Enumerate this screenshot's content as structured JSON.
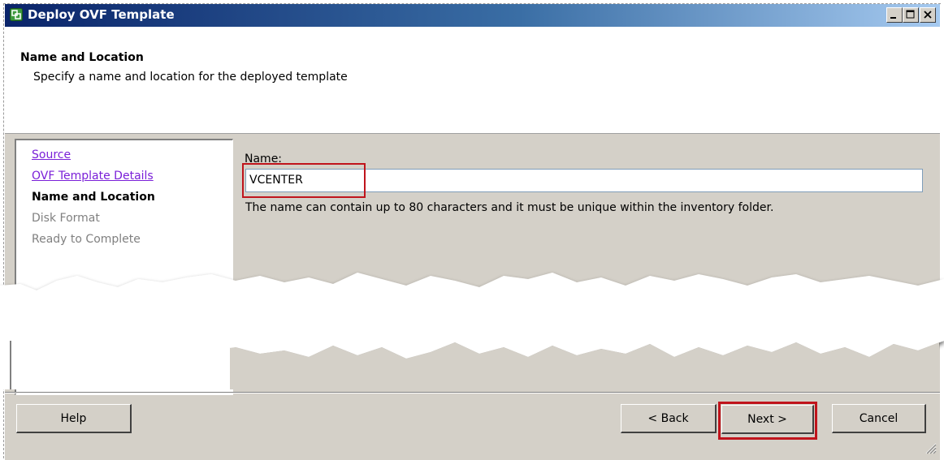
{
  "window": {
    "title": "Deploy OVF Template",
    "icon": "vsphere-app-icon",
    "controls": [
      "minimize-icon",
      "maximize-icon",
      "close-icon"
    ]
  },
  "header": {
    "title": "Name and Location",
    "subtitle": "Specify a name and location for the deployed template"
  },
  "steps": [
    {
      "label": "Source",
      "state": "link"
    },
    {
      "label": "OVF Template Details",
      "state": "link"
    },
    {
      "label": "Name and Location",
      "state": "current"
    },
    {
      "label": "Disk Format",
      "state": "disabled"
    },
    {
      "label": "Ready to Complete",
      "state": "disabled"
    }
  ],
  "form": {
    "name_label": "Name:",
    "name_value": "VCENTER",
    "hint": "The name can contain up to 80 characters and it must be unique within the inventory folder."
  },
  "buttons": {
    "help": "Help",
    "back": "< Back",
    "next": "Next >",
    "cancel": "Cancel"
  },
  "colors": {
    "highlight": "#c0141c",
    "link": "#7a1fd8",
    "window_bg": "#d4d0c8"
  }
}
